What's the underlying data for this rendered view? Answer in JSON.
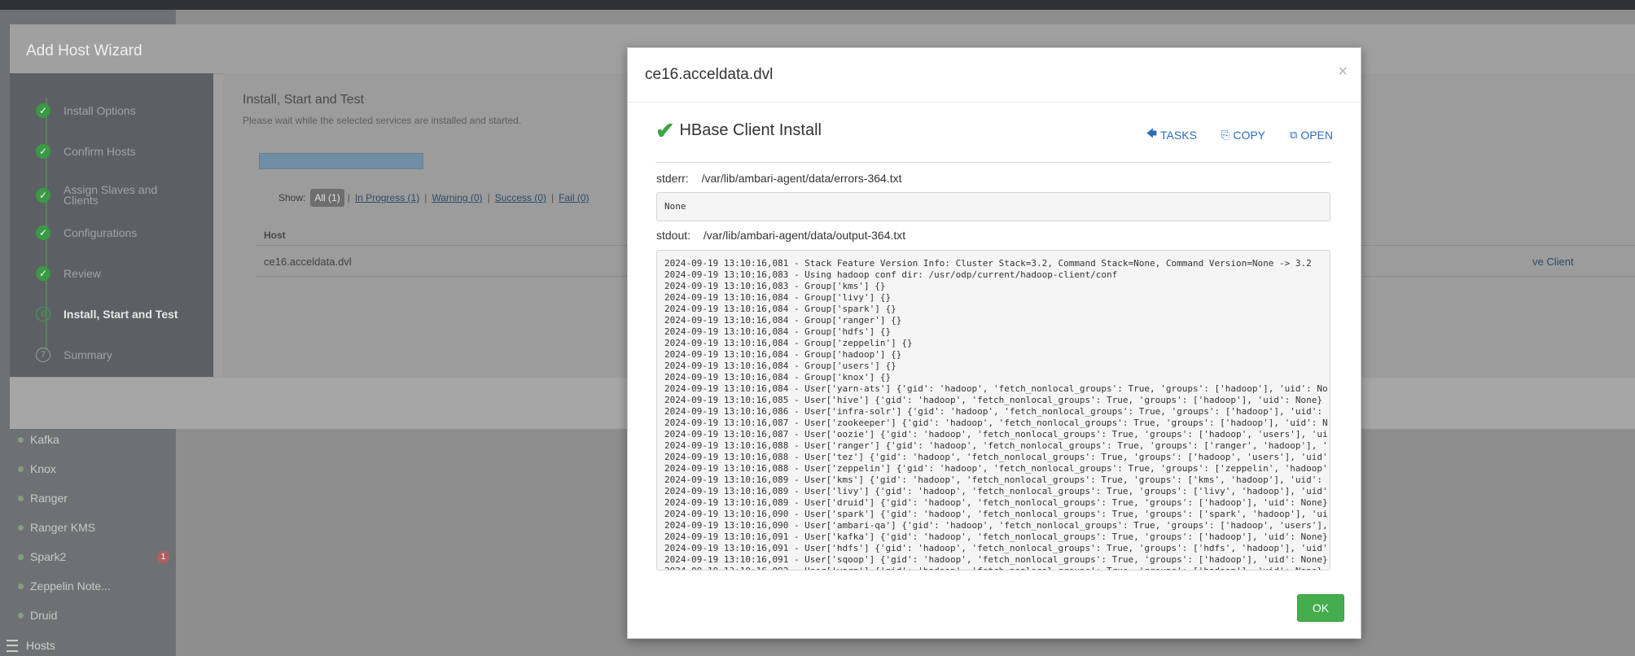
{
  "sidebar": {
    "services": [
      {
        "label": "Kafka"
      },
      {
        "label": "Knox"
      },
      {
        "label": "Ranger"
      },
      {
        "label": "Ranger KMS"
      },
      {
        "label": "Spark2",
        "badge": "1"
      },
      {
        "label": "Zeppelin Note..."
      },
      {
        "label": "Druid"
      }
    ],
    "hosts_label": "Hosts"
  },
  "wizard": {
    "title": "Add Host Wizard",
    "steps": [
      {
        "label": "Install Options",
        "status": "done"
      },
      {
        "label": "Confirm Hosts",
        "status": "done"
      },
      {
        "label": "Assign Slaves and Clients",
        "status": "done"
      },
      {
        "label": "Configurations",
        "status": "done"
      },
      {
        "label": "Review",
        "status": "done"
      },
      {
        "label": "Install, Start and Test",
        "status": "current",
        "number": "6"
      },
      {
        "label": "Summary",
        "status": "pending",
        "number": "7"
      }
    ],
    "body": {
      "title": "Install, Start and Test",
      "subtitle": "Please wait while the selected services are installed and started.",
      "progress_fraction": 0.2,
      "show_label": "Show:",
      "filters": {
        "all": "All (1)",
        "in_progress": "In Progress (1)",
        "warning": "Warning (0)",
        "success": "Success (0)",
        "fail": "Fail (0)"
      },
      "host_col_header": "Host",
      "host_name": "ce16.acceldata.dvl",
      "host_message": "ve Client"
    }
  },
  "modal": {
    "title": "ce16.acceldata.dvl",
    "close": "×",
    "task_title": "HBase Client Install",
    "actions": {
      "tasks": "TASKS",
      "copy": "COPY",
      "open": "OPEN"
    },
    "stderr_label": "stderr:",
    "stderr_path": "/var/lib/ambari-agent/data/errors-364.txt",
    "stderr_content": "None",
    "stdout_label": "stdout:",
    "stdout_path": "/var/lib/ambari-agent/data/output-364.txt",
    "stdout_lines": [
      "2024-09-19 13:10:16,081 - Stack Feature Version Info: Cluster Stack=3.2, Command Stack=None, Command Version=None -> 3.2",
      "2024-09-19 13:10:16,083 - Using hadoop conf dir: /usr/odp/current/hadoop-client/conf",
      "2024-09-19 13:10:16,083 - Group['kms'] {}",
      "2024-09-19 13:10:16,084 - Group['livy'] {}",
      "2024-09-19 13:10:16,084 - Group['spark'] {}",
      "2024-09-19 13:10:16,084 - Group['ranger'] {}",
      "2024-09-19 13:10:16,084 - Group['hdfs'] {}",
      "2024-09-19 13:10:16,084 - Group['zeppelin'] {}",
      "2024-09-19 13:10:16,084 - Group['hadoop'] {}",
      "2024-09-19 13:10:16,084 - Group['users'] {}",
      "2024-09-19 13:10:16,084 - Group['knox'] {}",
      "2024-09-19 13:10:16,084 - User['yarn-ats'] {'gid': 'hadoop', 'fetch_nonlocal_groups': True, 'groups': ['hadoop'], 'uid': None}",
      "2024-09-19 13:10:16,085 - User['hive'] {'gid': 'hadoop', 'fetch_nonlocal_groups': True, 'groups': ['hadoop'], 'uid': None}",
      "2024-09-19 13:10:16,086 - User['infra-solr'] {'gid': 'hadoop', 'fetch_nonlocal_groups': True, 'groups': ['hadoop'], 'uid': None}",
      "2024-09-19 13:10:16,087 - User['zookeeper'] {'gid': 'hadoop', 'fetch_nonlocal_groups': True, 'groups': ['hadoop'], 'uid': None}",
      "2024-09-19 13:10:16,087 - User['oozie'] {'gid': 'hadoop', 'fetch_nonlocal_groups': True, 'groups': ['hadoop', 'users'], 'uid': None}",
      "2024-09-19 13:10:16,088 - User['ranger'] {'gid': 'hadoop', 'fetch_nonlocal_groups': True, 'groups': ['ranger', 'hadoop'], 'uid': None}",
      "2024-09-19 13:10:16,088 - User['tez'] {'gid': 'hadoop', 'fetch_nonlocal_groups': True, 'groups': ['hadoop', 'users'], 'uid': None}",
      "2024-09-19 13:10:16,088 - User['zeppelin'] {'gid': 'hadoop', 'fetch_nonlocal_groups': True, 'groups': ['zeppelin', 'hadoop'], 'uid': None}",
      "2024-09-19 13:10:16,089 - User['kms'] {'gid': 'hadoop', 'fetch_nonlocal_groups': True, 'groups': ['kms', 'hadoop'], 'uid': None}",
      "2024-09-19 13:10:16,089 - User['livy'] {'gid': 'hadoop', 'fetch_nonlocal_groups': True, 'groups': ['livy', 'hadoop'], 'uid': None}",
      "2024-09-19 13:10:16,089 - User['druid'] {'gid': 'hadoop', 'fetch_nonlocal_groups': True, 'groups': ['hadoop'], 'uid': None}",
      "2024-09-19 13:10:16,090 - User['spark'] {'gid': 'hadoop', 'fetch_nonlocal_groups': True, 'groups': ['spark', 'hadoop'], 'uid': None}",
      "2024-09-19 13:10:16,090 - User['ambari-qa'] {'gid': 'hadoop', 'fetch_nonlocal_groups': True, 'groups': ['hadoop', 'users'], 'uid': None}",
      "2024-09-19 13:10:16,091 - User['kafka'] {'gid': 'hadoop', 'fetch_nonlocal_groups': True, 'groups': ['hadoop'], 'uid': None}",
      "2024-09-19 13:10:16,091 - User['hdfs'] {'gid': 'hadoop', 'fetch_nonlocal_groups': True, 'groups': ['hdfs', 'hadoop'], 'uid': None}",
      "2024-09-19 13:10:16,091 - User['sqoop'] {'gid': 'hadoop', 'fetch_nonlocal_groups': True, 'groups': ['hadoop'], 'uid': None}",
      "2024-09-19 13:10:16,092 - User['yarn'] {'gid': 'hadoop', 'fetch_nonlocal_groups': True, 'groups': ['hadoop'], 'uid': None}"
    ],
    "ok_label": "OK"
  },
  "colors": {
    "success_green": "#45ad4d",
    "link_blue": "#2a6ebb",
    "backdrop_gray": "#8a8a8a"
  },
  "icons": {
    "task_status": "check-icon",
    "tasks_back": "arrow-left-icon",
    "copy": "clipboard-icon",
    "open": "external-link-icon"
  }
}
